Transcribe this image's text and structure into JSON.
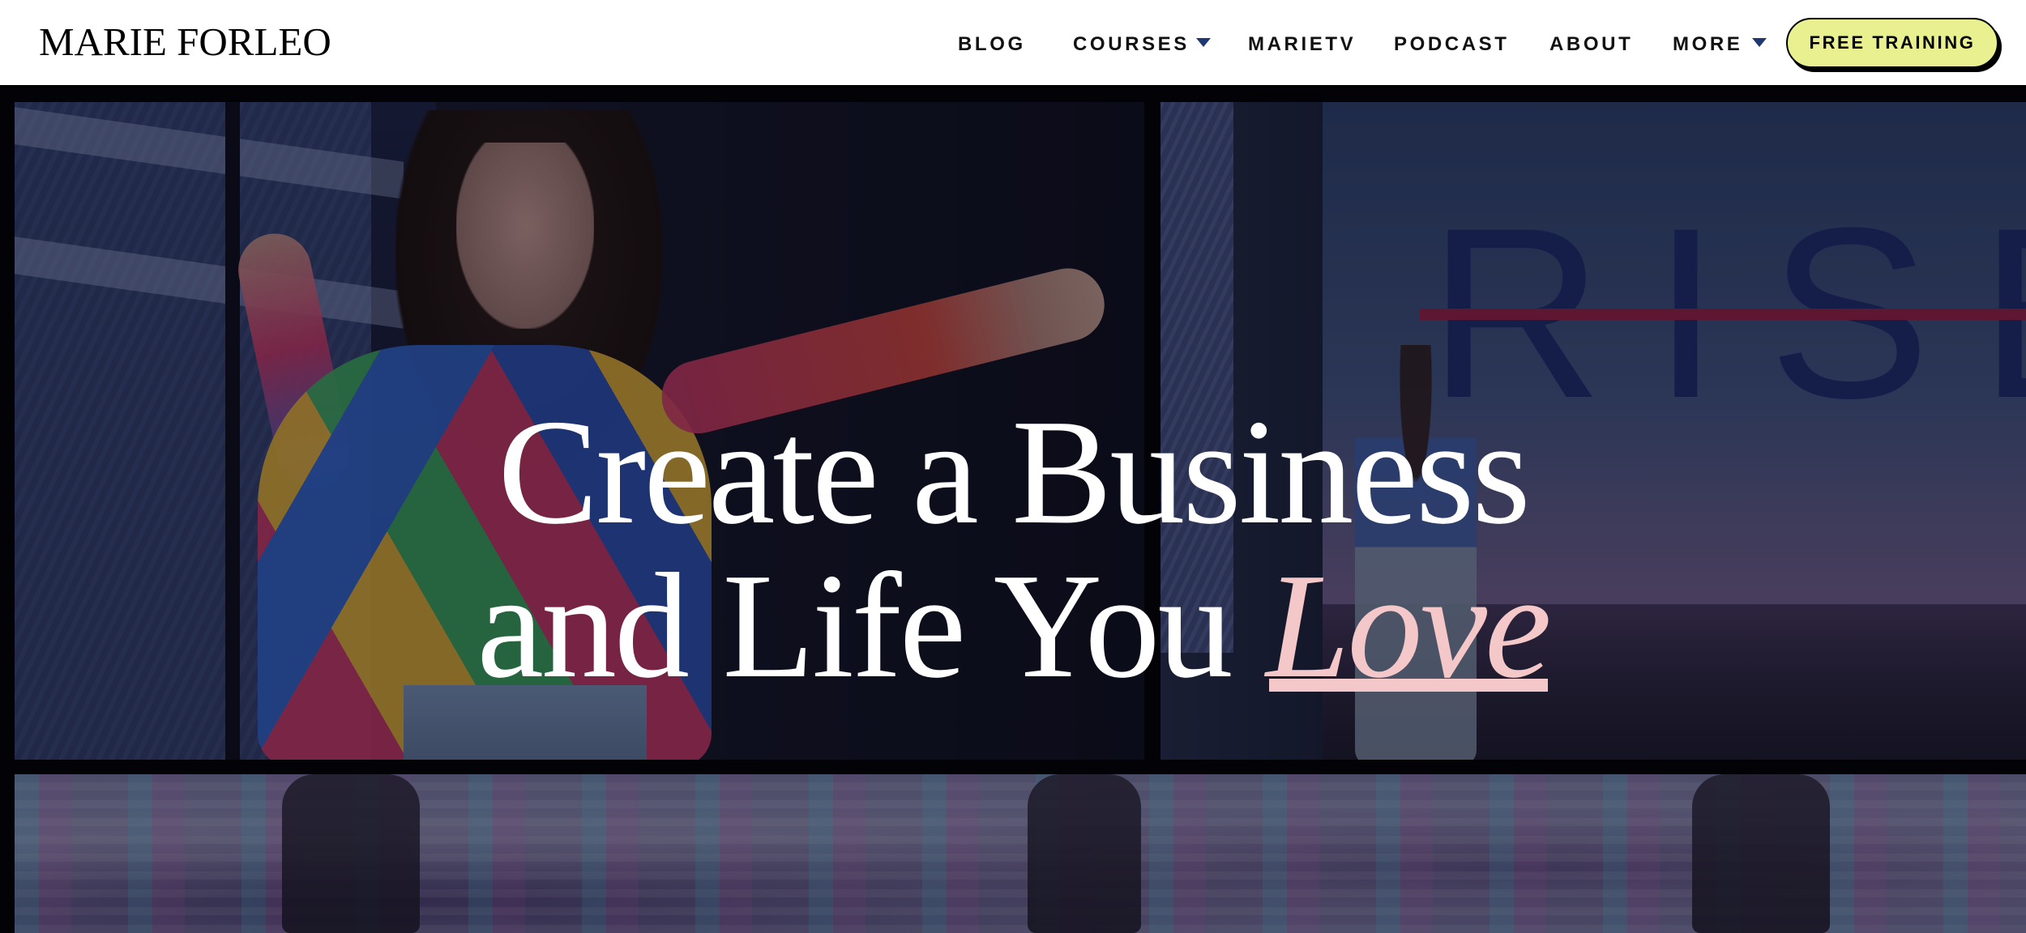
{
  "brand": {
    "logo_text": "MARIE FORLEO"
  },
  "nav": {
    "items": [
      {
        "label": "BLOG",
        "has_dropdown": false
      },
      {
        "label": "COURSES",
        "has_dropdown": true
      },
      {
        "label": "MARIETV",
        "has_dropdown": false
      },
      {
        "label": "PODCAST",
        "has_dropdown": false
      },
      {
        "label": "ABOUT",
        "has_dropdown": false
      },
      {
        "label": "MORE",
        "has_dropdown": true
      }
    ],
    "cta_label": "FREE TRAINING"
  },
  "hero": {
    "headline_line1": "Create a Business",
    "headline_line2_prefix": "and Life You ",
    "headline_accent": "Love",
    "stage_sign_text": "RISE"
  },
  "colors": {
    "cta_background": "#e8f08f",
    "accent_pink": "#f4c8c8",
    "caret_navy": "#1f3870"
  }
}
